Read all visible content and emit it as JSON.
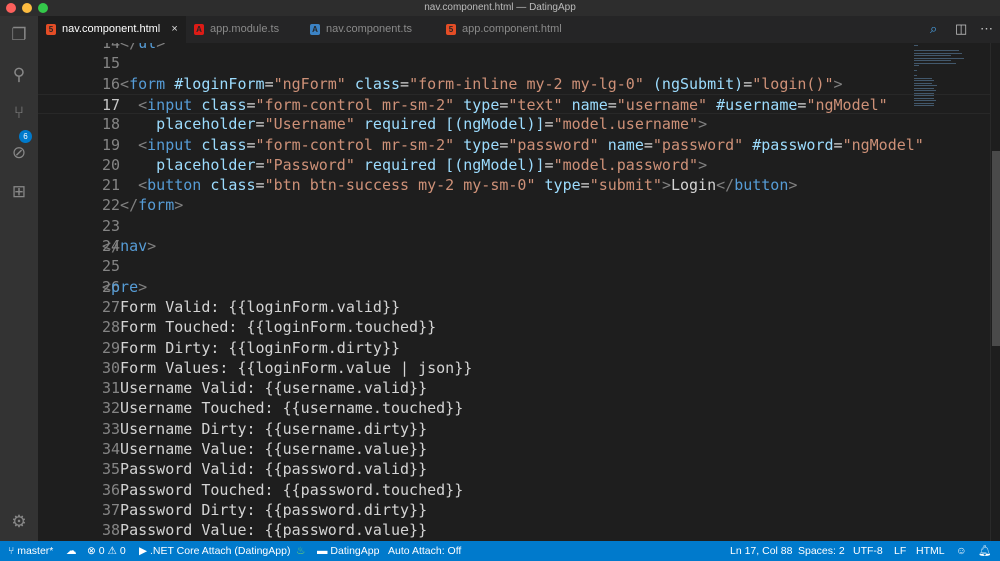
{
  "window": {
    "title": "nav.component.html — DatingApp"
  },
  "activity": {
    "scm_badge": "6"
  },
  "tabs": [
    {
      "label": "nav.component.html",
      "icon": "html5-icon",
      "color": "#e44d26",
      "active": true,
      "close": "×"
    },
    {
      "label": "app.module.ts",
      "icon": "angular-icon",
      "color": "#dd1b16"
    },
    {
      "label": "nav.component.ts",
      "icon": "angular-icon",
      "color": "#3b82c4"
    },
    {
      "label": "app.component.html",
      "icon": "html5-icon",
      "color": "#e44d26"
    }
  ],
  "editor": {
    "current_line": 17,
    "lines": [
      {
        "n": "14",
        "tokens": [
          [
            "p",
            "  </"
          ],
          [
            "t",
            "ul"
          ],
          [
            "p",
            ">"
          ]
        ]
      },
      {
        "n": "15",
        "tokens": []
      },
      {
        "n": "16",
        "tokens": [
          [
            "p",
            "  <"
          ],
          [
            "t",
            "form"
          ],
          [
            "a",
            " #loginForm"
          ],
          [
            "x",
            "="
          ],
          [
            "s",
            "\"ngForm\""
          ],
          [
            "a",
            " class"
          ],
          [
            "x",
            "="
          ],
          [
            "s",
            "\"form-inline my-2 my-lg-0\""
          ],
          [
            "a",
            " (ngSubmit)"
          ],
          [
            "x",
            "="
          ],
          [
            "s",
            "\"login()\""
          ],
          [
            "p",
            ">"
          ]
        ]
      },
      {
        "n": "17",
        "tokens": [
          [
            "p",
            "    <"
          ],
          [
            "t",
            "input"
          ],
          [
            "a",
            " class"
          ],
          [
            "x",
            "="
          ],
          [
            "s",
            "\"form-control mr-sm-2\""
          ],
          [
            "a",
            " type"
          ],
          [
            "x",
            "="
          ],
          [
            "s",
            "\"text\""
          ],
          [
            "a",
            " name"
          ],
          [
            "x",
            "="
          ],
          [
            "s",
            "\"username\""
          ],
          [
            "a",
            " #username"
          ],
          [
            "x",
            "="
          ],
          [
            "s",
            "\"ngModel\""
          ]
        ]
      },
      {
        "n": "18",
        "tokens": [
          [
            "a",
            "      placeholder"
          ],
          [
            "x",
            "="
          ],
          [
            "s",
            "\"Username\""
          ],
          [
            "a",
            " required"
          ],
          [
            "a",
            " [(ngModel)]"
          ],
          [
            "x",
            "="
          ],
          [
            "s",
            "\"model.username\""
          ],
          [
            "p",
            ">"
          ]
        ]
      },
      {
        "n": "19",
        "tokens": [
          [
            "p",
            "    <"
          ],
          [
            "t",
            "input"
          ],
          [
            "a",
            " class"
          ],
          [
            "x",
            "="
          ],
          [
            "s",
            "\"form-control mr-sm-2\""
          ],
          [
            "a",
            " type"
          ],
          [
            "x",
            "="
          ],
          [
            "s",
            "\"password\""
          ],
          [
            "a",
            " name"
          ],
          [
            "x",
            "="
          ],
          [
            "s",
            "\"password\""
          ],
          [
            "a",
            " #password"
          ],
          [
            "x",
            "="
          ],
          [
            "s",
            "\"ngModel\""
          ]
        ]
      },
      {
        "n": "20",
        "tokens": [
          [
            "a",
            "      placeholder"
          ],
          [
            "x",
            "="
          ],
          [
            "s",
            "\"Password\""
          ],
          [
            "a",
            " required"
          ],
          [
            "a",
            " [(ngModel)]"
          ],
          [
            "x",
            "="
          ],
          [
            "s",
            "\"model.password\""
          ],
          [
            "p",
            ">"
          ]
        ]
      },
      {
        "n": "21",
        "tokens": [
          [
            "p",
            "    <"
          ],
          [
            "t",
            "button"
          ],
          [
            "a",
            " class"
          ],
          [
            "x",
            "="
          ],
          [
            "s",
            "\"btn btn-success my-2 my-sm-0\""
          ],
          [
            "a",
            " type"
          ],
          [
            "x",
            "="
          ],
          [
            "s",
            "\"submit\""
          ],
          [
            "p",
            ">"
          ],
          [
            "x",
            "Login"
          ],
          [
            "p",
            "</"
          ],
          [
            "t",
            "button"
          ],
          [
            "p",
            ">"
          ]
        ]
      },
      {
        "n": "22",
        "tokens": [
          [
            "p",
            "  </"
          ],
          [
            "t",
            "form"
          ],
          [
            "p",
            ">"
          ]
        ]
      },
      {
        "n": "23",
        "tokens": []
      },
      {
        "n": "24",
        "tokens": [
          [
            "p",
            "</"
          ],
          [
            "t",
            "nav"
          ],
          [
            "p",
            ">"
          ]
        ]
      },
      {
        "n": "25",
        "tokens": []
      },
      {
        "n": "26",
        "tokens": [
          [
            "p",
            "<"
          ],
          [
            "t",
            "pre"
          ],
          [
            "p",
            ">"
          ]
        ]
      },
      {
        "n": "27",
        "tokens": [
          [
            "x",
            "  Form Valid: {{loginForm.valid}}"
          ]
        ]
      },
      {
        "n": "28",
        "tokens": [
          [
            "x",
            "  Form Touched: {{loginForm.touched}}"
          ]
        ]
      },
      {
        "n": "29",
        "tokens": [
          [
            "x",
            "  Form Dirty: {{loginForm.dirty}}"
          ]
        ]
      },
      {
        "n": "30",
        "tokens": [
          [
            "x",
            "  Form Values: {{loginForm.value | json}}"
          ]
        ]
      },
      {
        "n": "31",
        "tokens": [
          [
            "x",
            "  Username Valid: {{username.valid}}"
          ]
        ]
      },
      {
        "n": "32",
        "tokens": [
          [
            "x",
            "  Username Touched: {{username.touched}}"
          ]
        ]
      },
      {
        "n": "33",
        "tokens": [
          [
            "x",
            "  Username Dirty: {{username.dirty}}"
          ]
        ]
      },
      {
        "n": "34",
        "tokens": [
          [
            "x",
            "  Username Value: {{username.value}}"
          ]
        ]
      },
      {
        "n": "35",
        "tokens": [
          [
            "x",
            "  Password Valid: {{password.valid}}"
          ]
        ]
      },
      {
        "n": "36",
        "tokens": [
          [
            "x",
            "  Password Touched: {{password.touched}}"
          ]
        ]
      },
      {
        "n": "37",
        "tokens": [
          [
            "x",
            "  Password Dirty: {{password.dirty}}"
          ]
        ]
      },
      {
        "n": "38",
        "tokens": [
          [
            "x",
            "  Password Value: {{password.value}}"
          ]
        ]
      }
    ]
  },
  "status": {
    "branch": "master*",
    "errors": "0",
    "warnings": "0",
    "debug": ".NET Core Attach (DatingApp)",
    "folder": "DatingApp",
    "auto_attach": "Auto Attach: Off",
    "position": "Ln 17, Col 88",
    "spaces": "Spaces: 2",
    "encoding": "UTF-8",
    "eol": "LF",
    "language": "HTML"
  }
}
